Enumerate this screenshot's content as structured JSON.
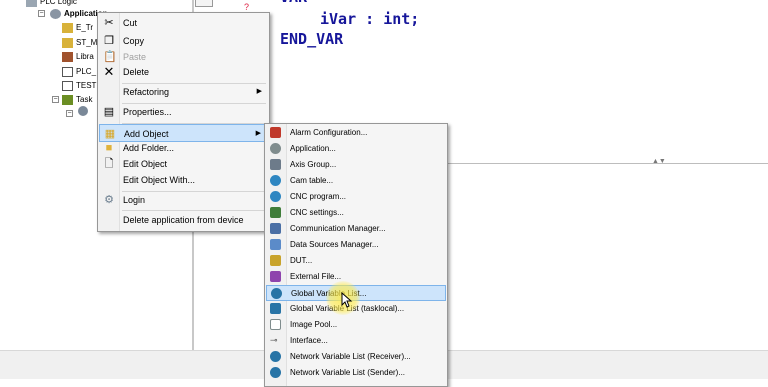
{
  "tree": {
    "items": [
      {
        "label": "PLC Logic"
      },
      {
        "label": "Application"
      },
      {
        "label": "E_Tr"
      },
      {
        "label": "ST_M"
      },
      {
        "label": "Libra"
      },
      {
        "label": "PLC_"
      },
      {
        "label": "TEST"
      },
      {
        "label": "Task"
      }
    ]
  },
  "code": {
    "line1": "iVar : int;",
    "line2": "END_VAR"
  },
  "context_menu": {
    "items": [
      {
        "label": "Cut",
        "icon": "scissors-icon"
      },
      {
        "label": "Copy",
        "icon": "copy-icon"
      },
      {
        "label": "Paste",
        "icon": "paste-icon"
      },
      {
        "label": "Delete",
        "icon": "delete-icon"
      },
      {
        "label": "Refactoring",
        "icon": ""
      },
      {
        "label": "Properties...",
        "icon": "properties-icon"
      },
      {
        "label": "Add Object",
        "icon": "add-object-icon"
      },
      {
        "label": "Add Folder...",
        "icon": "folder-icon"
      },
      {
        "label": "Edit Object",
        "icon": "edit-object-icon"
      },
      {
        "label": "Edit Object With...",
        "icon": ""
      },
      {
        "label": "Login",
        "icon": "login-icon"
      },
      {
        "label": "Delete application from device",
        "icon": ""
      }
    ]
  },
  "submenu": {
    "items": [
      {
        "label": "Alarm Configuration...",
        "color": "#c0392b"
      },
      {
        "label": "Application...",
        "color": "#7f8c8d"
      },
      {
        "label": "Axis Group...",
        "color": "#6d7b8a"
      },
      {
        "label": "Cam table...",
        "color": "#2e86c1"
      },
      {
        "label": "CNC program...",
        "color": "#2e86c1"
      },
      {
        "label": "CNC settings...",
        "color": "#3f7d3a"
      },
      {
        "label": "Communication Manager...",
        "color": "#4a6fa5"
      },
      {
        "label": "Data Sources Manager...",
        "color": "#5b8bc9"
      },
      {
        "label": "DUT...",
        "color": "#c8a32b"
      },
      {
        "label": "External File...",
        "color": "#8e44ad"
      },
      {
        "label": "Global Variable List...",
        "color": "#2874a6"
      },
      {
        "label": "Global Variable List (tasklocal)...",
        "color": "#2874a6"
      },
      {
        "label": "Image Pool...",
        "color": "#7f8c8d"
      },
      {
        "label": "Interface...",
        "color": "#555555"
      },
      {
        "label": "Network Variable List (Receiver)...",
        "color": "#2874a6"
      },
      {
        "label": "Network Variable List (Sender)...",
        "color": "#2874a6"
      }
    ]
  }
}
